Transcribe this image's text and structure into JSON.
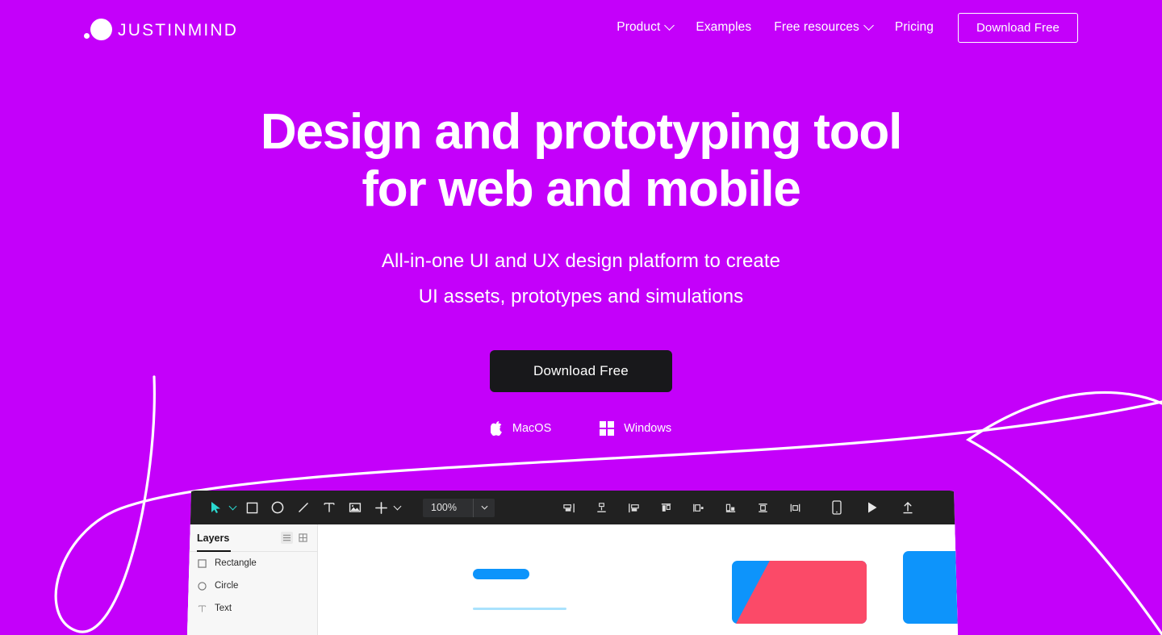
{
  "theme": {
    "background": "#c400fa",
    "accent_dark": "#18181b",
    "text_on_brand": "#ffffff",
    "app_toolbar": "#212121",
    "canvas_blue": "#0d94fb",
    "canvas_pink": "#fb4a68",
    "canvas_light_blue": "#a9e2fd",
    "cursor_teal": "#2ad9d0"
  },
  "header": {
    "logo": {
      "text": "JUSTINMIND",
      "mark_small_dot": "logo-dot-small",
      "mark_large_dot": "logo-dot-large"
    },
    "nav": [
      {
        "label": "Product",
        "has_dropdown": true
      },
      {
        "label": "Examples",
        "has_dropdown": false
      },
      {
        "label": "Free resources",
        "has_dropdown": true
      },
      {
        "label": "Pricing",
        "has_dropdown": false
      }
    ],
    "cta_button": "Download Free"
  },
  "hero": {
    "title_line1": "Design and prototyping tool",
    "title_line2": "for web and mobile",
    "subtitle_line1": "All-in-one UI and UX design platform to create",
    "subtitle_line2": "UI assets, prototypes and simulations",
    "cta_button": "Download Free",
    "os_options": [
      {
        "label": "MacOS",
        "icon": "apple-icon"
      },
      {
        "label": "Windows",
        "icon": "windows-icon"
      }
    ]
  },
  "app_preview": {
    "toolbar": {
      "tools": [
        {
          "name": "select-tool",
          "icon": "cursor-icon"
        },
        {
          "name": "rectangle-tool",
          "icon": "square-icon"
        },
        {
          "name": "ellipse-tool",
          "icon": "circle-icon"
        },
        {
          "name": "line-tool",
          "icon": "line-icon"
        },
        {
          "name": "text-tool",
          "icon": "text-t-icon"
        },
        {
          "name": "image-tool",
          "icon": "image-icon"
        },
        {
          "name": "add-tool",
          "icon": "plus-icon"
        }
      ],
      "zoom_value": "100%",
      "align_tools": [
        {
          "name": "align-left",
          "icon": "align-left-icon"
        },
        {
          "name": "align-top",
          "icon": "align-top-icon"
        },
        {
          "name": "align-right",
          "icon": "align-right-icon"
        },
        {
          "name": "align-center-vertical",
          "icon": "align-center-v-icon"
        },
        {
          "name": "distribute-horizontal",
          "icon": "distribute-h-icon"
        },
        {
          "name": "align-bottom",
          "icon": "align-bottom-icon"
        },
        {
          "name": "align-middle",
          "icon": "align-middle-icon"
        },
        {
          "name": "distribute-vertical",
          "icon": "distribute-v-icon"
        }
      ],
      "actions": [
        {
          "name": "device-preview",
          "icon": "phone-icon"
        },
        {
          "name": "play-simulation",
          "icon": "play-icon"
        },
        {
          "name": "share-publish",
          "icon": "upload-icon"
        }
      ]
    },
    "layers_panel": {
      "title": "Layers",
      "view_toggles": [
        {
          "name": "list-view",
          "icon": "list-icon",
          "active": true
        },
        {
          "name": "grid-view",
          "icon": "grid-icon",
          "active": false
        }
      ],
      "items": [
        {
          "label": "Rectangle",
          "icon": "square-icon"
        },
        {
          "label": "Circle",
          "icon": "circle-icon"
        },
        {
          "label": "Text",
          "icon": "text-t-icon"
        }
      ]
    },
    "canvas_shapes": [
      {
        "name": "blue-pill",
        "color": "#0d94fb"
      },
      {
        "name": "light-blue-line",
        "color": "#a9e2fd"
      },
      {
        "name": "split-card",
        "colors": [
          "#0d94fb",
          "#fb4a68"
        ]
      },
      {
        "name": "solid-blue-card",
        "color": "#0d94fb"
      }
    ]
  }
}
